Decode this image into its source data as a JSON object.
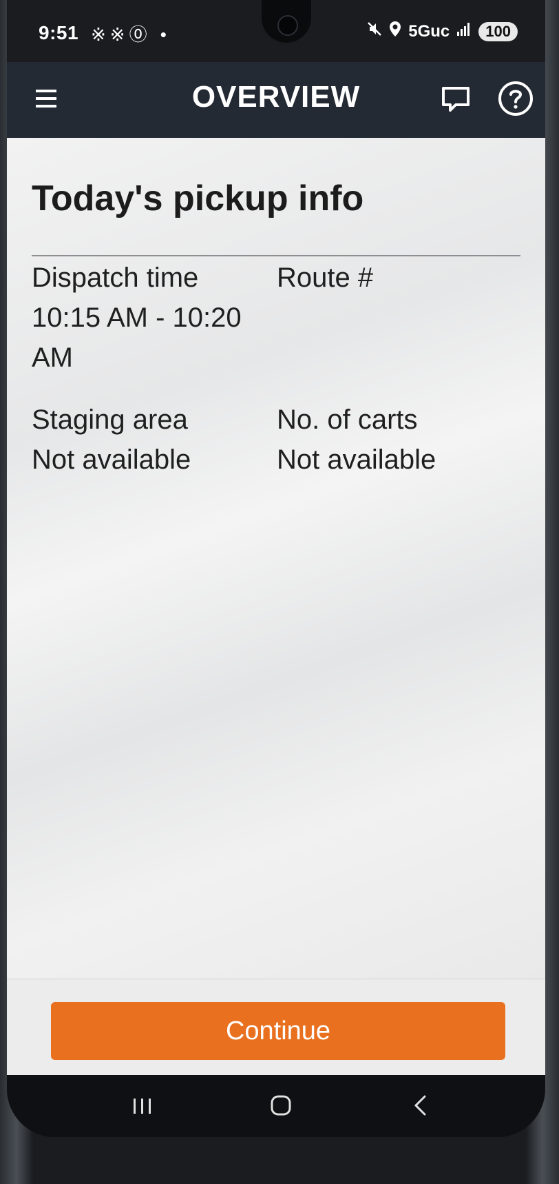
{
  "status_bar": {
    "time": "9:51",
    "left_icons": "※※⓪ •",
    "network": "5Guc",
    "battery": "100"
  },
  "app_bar": {
    "title": "OVERVIEW",
    "icons": [
      "menu-icon",
      "chat-icon",
      "help-icon"
    ]
  },
  "main": {
    "title": "Today's pickup info",
    "fields": [
      {
        "label": "Dispatch time",
        "value": "10:15 AM - 10:20 AM"
      },
      {
        "label": "Route #",
        "value": ""
      },
      {
        "label": "Staging area",
        "value": "Not available"
      },
      {
        "label": "No. of carts",
        "value": "Not available"
      }
    ]
  },
  "actions": {
    "continue_label": "Continue"
  },
  "nav": {
    "icons": [
      "recents-icon",
      "home-icon",
      "back-icon"
    ]
  },
  "colors": {
    "accent": "#e9701f",
    "app_bar": "#232a34",
    "background": "#f0f0f0"
  }
}
